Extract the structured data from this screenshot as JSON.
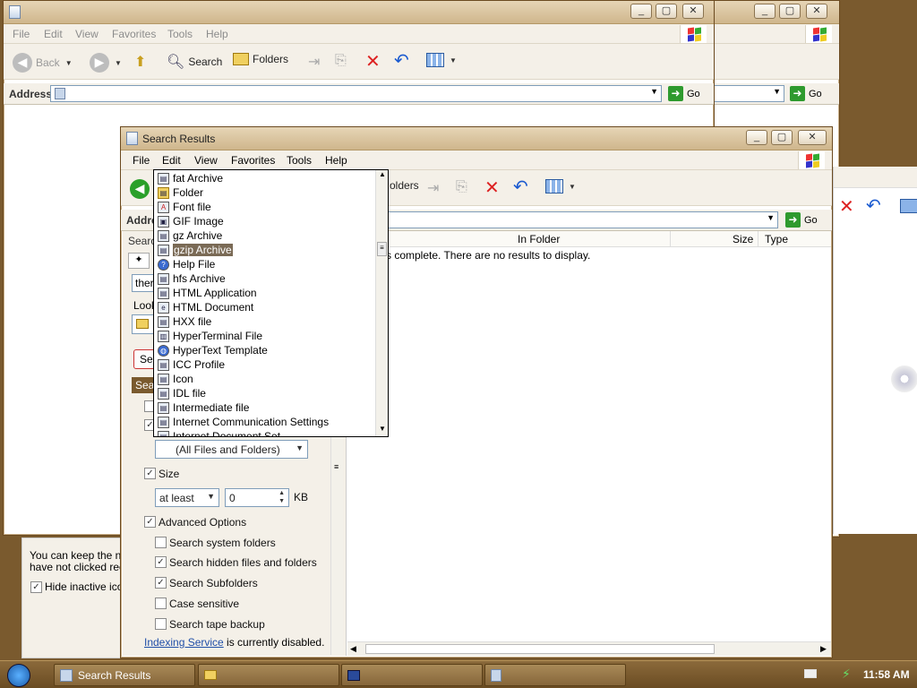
{
  "back_windows": {
    "menu": [
      "File",
      "Edit",
      "View",
      "Favorites",
      "Tools",
      "Help"
    ],
    "toolbar": {
      "back": "Back",
      "search": "Search",
      "folders": "Folders"
    },
    "address_label": "Address",
    "go_label": "Go",
    "notification_panel": {
      "line1": "You can keep the no",
      "line2": "have not clicked rece",
      "checkbox_label": "Hide inactive icon"
    }
  },
  "search_window": {
    "title": "Search Results",
    "menu": [
      "File",
      "Edit",
      "View",
      "Favorites",
      "Tools",
      "Help"
    ],
    "toolbar": {
      "folders": "olders"
    },
    "address_label": "Addre",
    "go_label": "Go",
    "left_pane": {
      "search_header": "Searc",
      "named_field_value": "ther",
      "look_in_label": "Look",
      "search_button": "Sea",
      "section_header": "Sear",
      "file_type_value": "(All Files and Folders)",
      "size_label": "Size",
      "size_mode": "at least",
      "size_value": "0",
      "size_unit": "KB",
      "advanced_label": "Advanced Options",
      "options": [
        {
          "label": "Search system folders",
          "checked": false
        },
        {
          "label": "Search hidden files and folders",
          "checked": true
        },
        {
          "label": "Search Subfolders",
          "checked": true
        },
        {
          "label": "Case sensitive",
          "checked": false
        },
        {
          "label": "Search tape backup",
          "checked": false
        }
      ],
      "indexing_link": "Indexing Service",
      "indexing_rest": " is currently disabled."
    },
    "results": {
      "columns": [
        "In Folder",
        "Size",
        "Type"
      ],
      "message": "s complete. There are no results to display."
    }
  },
  "file_type_dropdown": {
    "items": [
      {
        "label": "fat Archive",
        "icon": "archive-icon"
      },
      {
        "label": "Folder",
        "icon": "folder-icon"
      },
      {
        "label": "Font file",
        "icon": "font-icon"
      },
      {
        "label": "GIF Image",
        "icon": "image-icon"
      },
      {
        "label": "gz Archive",
        "icon": "archive-icon"
      },
      {
        "label": "gzip Archive",
        "icon": "archive-icon",
        "selected": true
      },
      {
        "label": "Help File",
        "icon": "help-icon"
      },
      {
        "label": "hfs Archive",
        "icon": "archive-icon"
      },
      {
        "label": "HTML Application",
        "icon": "app-icon"
      },
      {
        "label": "HTML Document",
        "icon": "ie-icon"
      },
      {
        "label": "HXX file",
        "icon": "file-icon"
      },
      {
        "label": "HyperTerminal File",
        "icon": "terminal-icon"
      },
      {
        "label": "HyperText Template",
        "icon": "globe-icon"
      },
      {
        "label": "ICC Profile",
        "icon": "file-icon"
      },
      {
        "label": "Icon",
        "icon": "file-icon"
      },
      {
        "label": "IDL file",
        "icon": "file-icon"
      },
      {
        "label": "Intermediate file",
        "icon": "file-icon"
      },
      {
        "label": "Internet Communication Settings",
        "icon": "file-icon"
      },
      {
        "label": "Internet Document Set",
        "icon": "file-icon"
      }
    ]
  },
  "taskbar": {
    "buttons": [
      "Search Results",
      "",
      "",
      ""
    ],
    "clock": "11:58 AM"
  },
  "colors": {
    "accent_brown": "#7a5a2e",
    "selection": "#7a6a55",
    "link": "#1f4fa8"
  }
}
